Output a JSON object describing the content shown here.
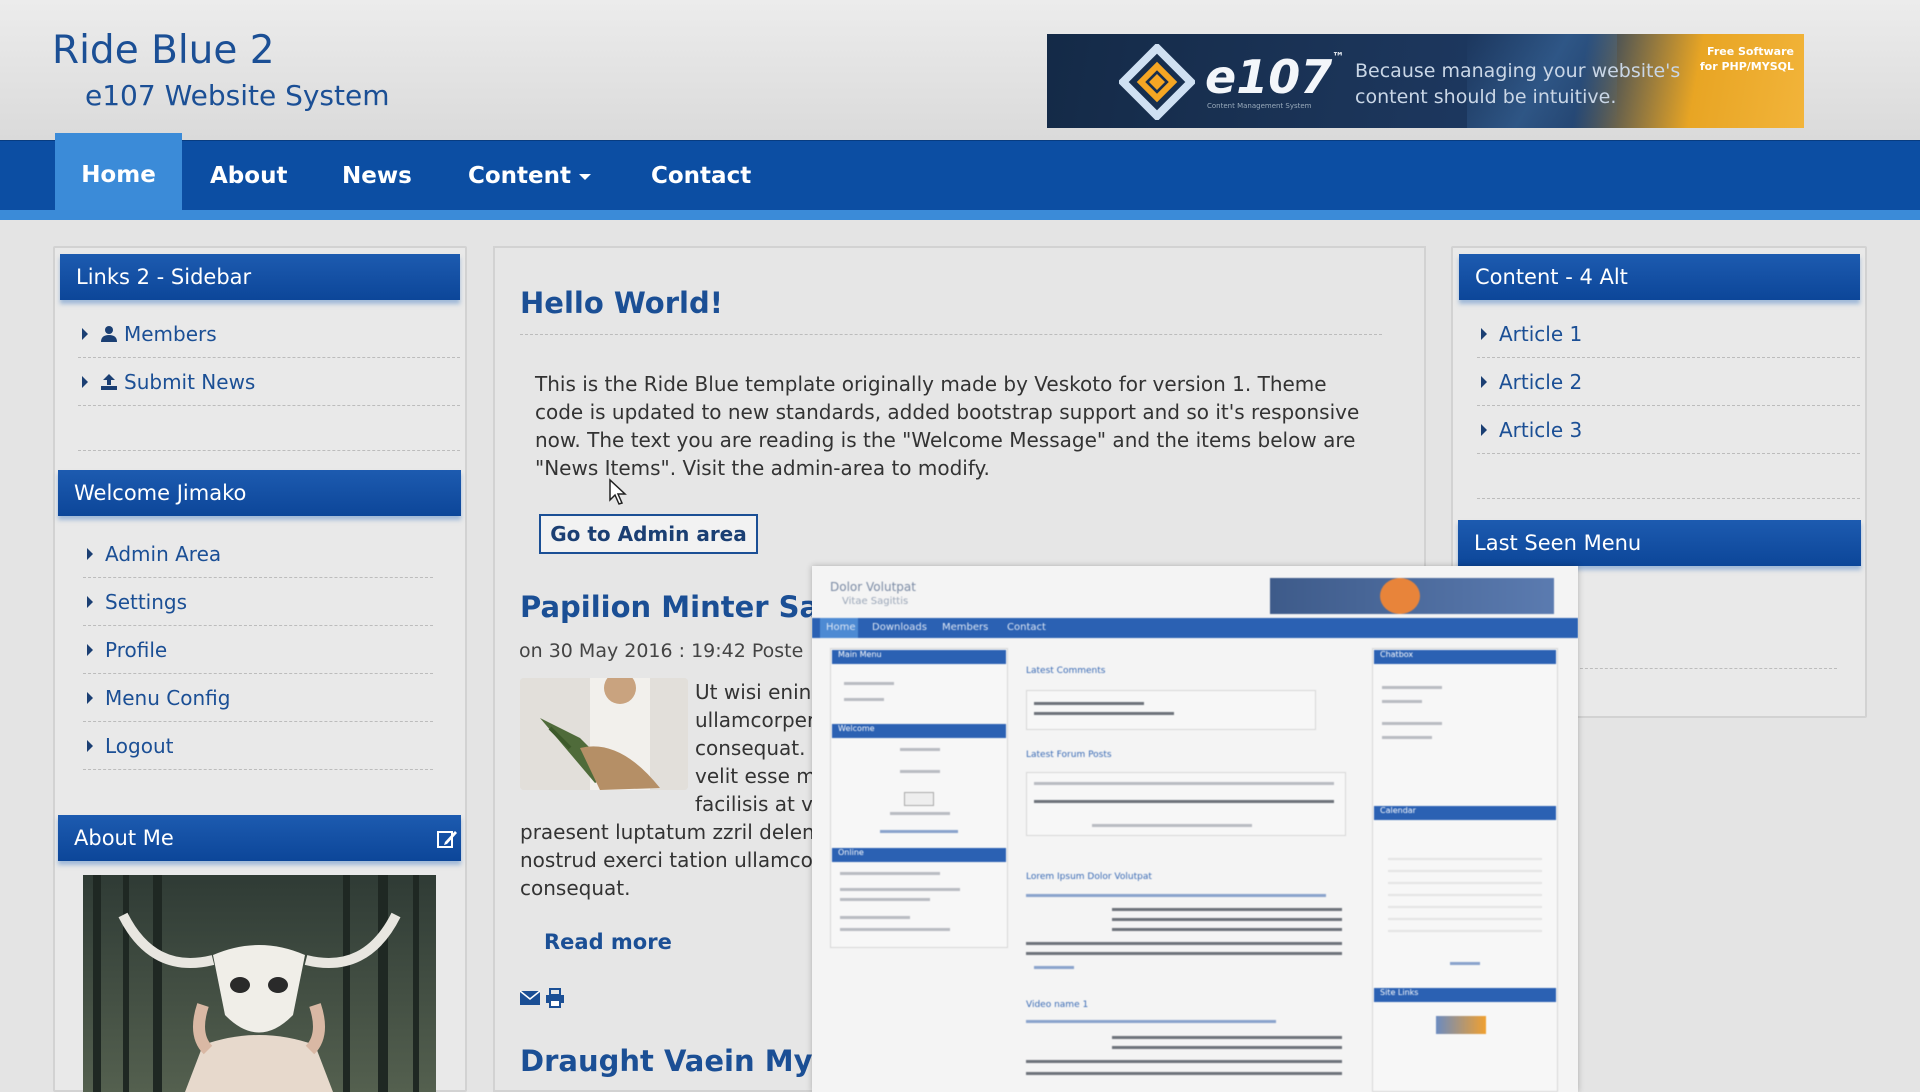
{
  "header": {
    "title": "Ride Blue 2",
    "subtitle": "e107 Website System",
    "banner": {
      "logo_text": "e107",
      "logo_caption": "Content Management System",
      "tagline": "Because managing your website's content should be intuitive.",
      "free_text": "Free Software for PHP/MYSQL"
    }
  },
  "nav": {
    "items": [
      {
        "label": "Home",
        "active": true
      },
      {
        "label": "About"
      },
      {
        "label": "News"
      },
      {
        "label": "Content"
      },
      {
        "label": "Contact"
      }
    ]
  },
  "left_sidebar": {
    "links_panel": {
      "title": "Links 2 - Sidebar",
      "items": [
        {
          "label": "Members",
          "icon": "user-icon"
        },
        {
          "label": "Submit News",
          "icon": "upload-icon"
        }
      ]
    },
    "welcome_panel": {
      "title": "Welcome Jimako",
      "items": [
        "Admin Area",
        "Settings",
        "Profile",
        "Menu Config",
        "Logout"
      ]
    },
    "about_panel": {
      "title": "About Me",
      "edit_icon": "edit-icon"
    }
  },
  "main": {
    "welcome_title": "Hello World!",
    "welcome_lines": [
      "This is the Ride Blue template originally made by Veskoto for version 1. Theme",
      "code is updated to new standards, added bootstrap support and so it's responsive",
      "now. The text you are reading is the \"Welcome Message\" and the items below are",
      "\"News Items\". Visit the admin-area to modify."
    ],
    "admin_button": "Go to Admin area",
    "news1": {
      "title": "Papilion Minter Sav",
      "meta": "on 30 May 2016 : 19:42   Poste",
      "wrap_lines": [
        "Ut wisi enin",
        "ullamcorper",
        "consequat.",
        "velit esse m",
        "facilisis at v"
      ],
      "full_lines": [
        "praesent luptatum zzril delen",
        "nostrud exerci tation ullamco",
        "consequat."
      ],
      "read_more": "Read more"
    },
    "news2": {
      "title": "Draught Vaein Myn"
    }
  },
  "right_sidebar": {
    "content_panel": {
      "title": "Content - 4 Alt",
      "items": [
        "Article 1",
        "Article 2",
        "Article 3"
      ]
    },
    "last_seen_panel": {
      "title": "Last Seen Menu"
    }
  },
  "overlay_preview": {
    "site_title": "Dolor Volutpat",
    "site_sub": "Vitae Sagittis",
    "nav": [
      "Home",
      "Downloads",
      "Members",
      "Contact"
    ],
    "left_titles": [
      "Main Menu",
      "Welcome",
      "Online"
    ],
    "center_titles": [
      "Latest Comments",
      "Latest Forum Posts",
      "Lorem Ipsum Dolor Volutpat",
      "Video name 1"
    ],
    "right_titles": [
      "Chatbox",
      "Calendar",
      "Site Links"
    ]
  },
  "colors": {
    "nav_blue": "#0c4ea3",
    "nav_active": "#3b8bd8",
    "heading_blue": "#1b4f95"
  }
}
